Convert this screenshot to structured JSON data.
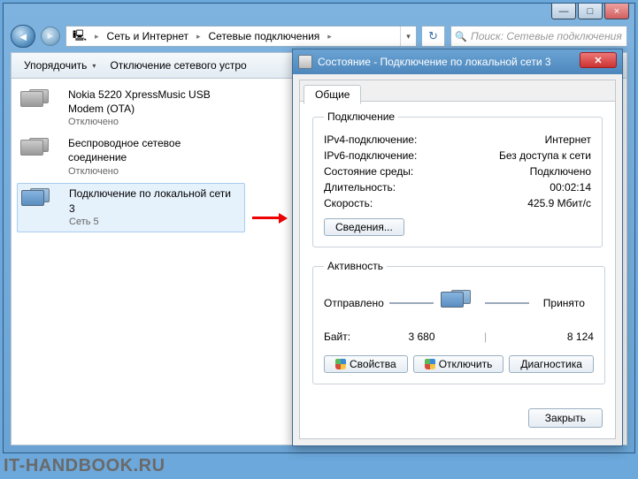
{
  "window": {
    "min_icon": "—",
    "max_icon": "□",
    "close_icon": "×"
  },
  "nav": {
    "back_icon": "◄",
    "fwd_icon": "►",
    "drop_icon": "▸",
    "refresh_icon": "↻"
  },
  "breadcrumb": {
    "root_icon": "▸",
    "part1": "Сеть и Интернет",
    "part2": "Сетевые подключения"
  },
  "search": {
    "placeholder": "Поиск: Сетевые подключения"
  },
  "toolbar": {
    "organize": "Упорядочить",
    "disable": "Отключение сетевого устро",
    "help": "?"
  },
  "connections": [
    {
      "title": "Nokia 5220 XpressMusic USB Modem (OTA)",
      "status": "Отключено"
    },
    {
      "title": "Беспроводное сетевое соединение",
      "status": "Отключено"
    },
    {
      "title": "Подключение по локальной сети 3",
      "status": "Сеть 5"
    }
  ],
  "dialog": {
    "title": "Состояние - Подключение по локальной сети 3",
    "close_icon": "✕",
    "tab": "Общие",
    "conn_group": "Подключение",
    "rows": {
      "ipv4_l": "IPv4-подключение:",
      "ipv4_v": "Интернет",
      "ipv6_l": "IPv6-подключение:",
      "ipv6_v": "Без доступа к сети",
      "media_l": "Состояние среды:",
      "media_v": "Подключено",
      "dur_l": "Длительность:",
      "dur_v": "00:02:14",
      "speed_l": "Скорость:",
      "speed_v": "425.9 Мбит/с"
    },
    "details_btn": "Сведения...",
    "act_group": "Активность",
    "sent": "Отправлено",
    "recv": "Принято",
    "bytes_l": "Байт:",
    "bytes_sent": "3 680",
    "bytes_recv": "8 124",
    "props_btn": "Свойства",
    "disable_btn": "Отключить",
    "diag_btn": "Диагностика",
    "close_btn": "Закрыть"
  },
  "watermark": "IT-HANDBOOK.RU"
}
